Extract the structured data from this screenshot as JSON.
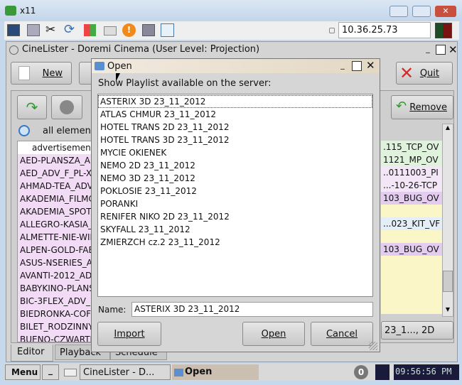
{
  "outer": {
    "title": "x11",
    "ip": "10.36.25.73"
  },
  "app": {
    "title": "CineLister - Doremi Cinema (User Level: Projection)",
    "new_label": "New",
    "quit_label": "Quit",
    "remove_label": "Remove",
    "filter_label": "all element",
    "left_list": [
      "advertisemen",
      "AED-PLANSZA_A",
      "AED_ADV_F_PL-X",
      "AHMAD-TEA_ADV",
      "AKADEMIA_FILMC",
      "AKADEMIA_SPOT",
      "ALLEGRO-KASIA_A",
      "ALMETTE-NIE-WIE",
      "ALPEN-GOLD-FAE",
      "ASUS-NSERIES_A",
      "AVANTI-2012_AD",
      "BABYKINO-PLANS",
      "BIC-3FLEX_ADV_I",
      "BIEDRONKA-COFF",
      "BILET_RODZINNY",
      "BUENO-CZWARTE"
    ],
    "right_list": [
      {
        "text": ".115_TCP_OV",
        "color": "#dff3dc"
      },
      {
        "text": "1121_MP_OV",
        "color": "#dff3dc"
      },
      {
        "text": "..0111003_PI",
        "color": "#f3e6f6"
      },
      {
        "text": "...-10-26-TCP",
        "color": "#f3e6f6"
      },
      {
        "text": "103_BUG_OV",
        "color": "#e3ccef"
      },
      {
        "text": "",
        "color": "#fbf6c8"
      },
      {
        "text": "...023_KIT_VF",
        "color": "#e3eef8"
      },
      {
        "text": "",
        "color": "#fbf6c8"
      },
      {
        "text": "103_BUG_OV",
        "color": "#e3ccef"
      }
    ],
    "right_button": "23_1..., 2D",
    "tabs": [
      "Editor",
      "Playback",
      "Schedule"
    ]
  },
  "dialog": {
    "title": "Open",
    "prompt": "Show Playlist available on the server:",
    "items": [
      "ASTERIX 3D 23_11_2012",
      "ATLAS CHMUR 23_11_2012",
      "HOTEL TRANS 2D 23_11_2012",
      "HOTEL TRANS 3D 23_11_2012",
      "MYCIE OKIENEK",
      "NEMO 2D 23_11_2012",
      "NEMO 3D 23_11_2012",
      "POKLOSIE 23_11_2012",
      "PORANKI",
      "RENIFER NIKO 2D 23_11_2012",
      "SKYFALL 23_11_2012",
      "ZMIERZCH cz.2 23_11_2012"
    ],
    "selected": 0,
    "name_label": "Name:",
    "name_value": "ASTERIX 3D 23_11_2012",
    "import_label": "Import",
    "open_label": "Open",
    "cancel_label": "Cancel"
  },
  "taskbar": {
    "menu": "Menu",
    "tasks": [
      "CineLister - D...",
      "Open"
    ],
    "badge": "0",
    "clock": "09:56:56 PM"
  }
}
